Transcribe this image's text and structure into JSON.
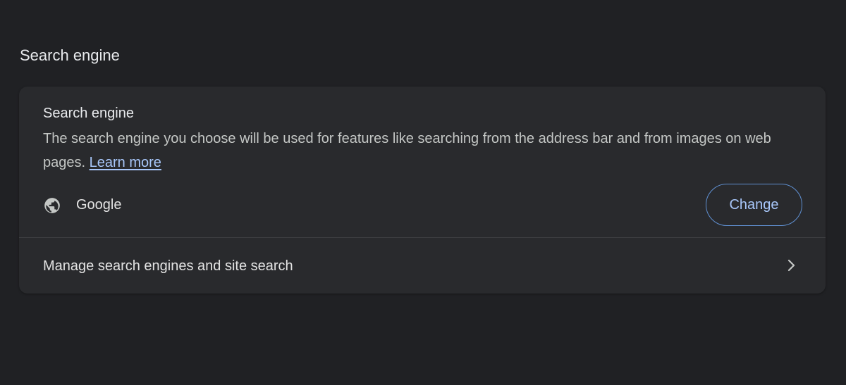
{
  "section": {
    "title": "Search engine"
  },
  "card": {
    "title": "Search engine",
    "description": "The search engine you choose will be used for features like searching from the address bar and from images on web pages.",
    "learn_more": "Learn more",
    "engine": {
      "icon": "globe-icon",
      "name": "Google",
      "change_label": "Change"
    },
    "manage": {
      "label": "Manage search engines and site search",
      "icon": "chevron-right-icon"
    }
  },
  "colors": {
    "background": "#202124",
    "card": "#292a2d",
    "link": "#a8c7fa",
    "button_border": "#5f8fd0"
  }
}
